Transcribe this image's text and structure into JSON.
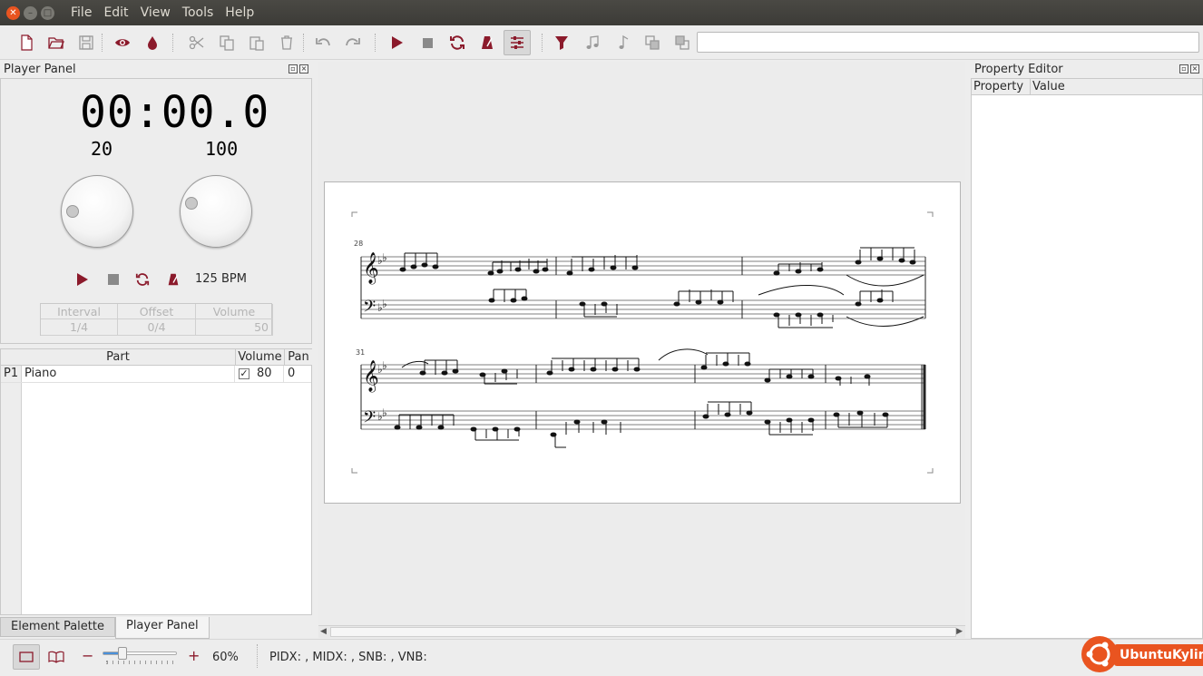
{
  "window": {
    "menu": [
      "File",
      "Edit",
      "View",
      "Tools",
      "Help"
    ]
  },
  "toolbar": {
    "icons": [
      "new-file",
      "open-folder",
      "save",
      "eye",
      "drop",
      "cut",
      "copy",
      "paste",
      "delete",
      "undo",
      "redo",
      "play",
      "stop",
      "loop",
      "metronome",
      "mixer",
      "filter",
      "note",
      "notes",
      "bring-front",
      "send-back"
    ],
    "search_value": ""
  },
  "player_panel": {
    "title": "Player Panel",
    "time_display": "00:00.0",
    "left_knob_value": "20",
    "right_knob_value": "100",
    "bpm": "125 BPM",
    "table": {
      "headers": [
        "Interval",
        "Offset",
        "Volume"
      ],
      "values": [
        "1/4",
        "0/4",
        "50"
      ]
    }
  },
  "parts_table": {
    "headers": [
      "Part",
      "Volume",
      "Pan"
    ],
    "rows": [
      {
        "id": "P1",
        "name": "Piano",
        "checked": true,
        "volume": "80",
        "pan": "0"
      }
    ]
  },
  "bottom_tabs": [
    "Element Palette",
    "Player Panel"
  ],
  "score": {
    "measure_numbers": [
      "28",
      "31"
    ]
  },
  "property_editor": {
    "title": "Property Editor",
    "headers": [
      "Property",
      "Value"
    ]
  },
  "status": {
    "zoom": "60%",
    "slider_level": 0.2,
    "info": "PIDX: , MIDX: , SNB: , VNB:"
  },
  "branding": {
    "logo_text": "UbuntuKylin",
    "accent": "#e95420",
    "icon_red": "#8b1a2b"
  }
}
